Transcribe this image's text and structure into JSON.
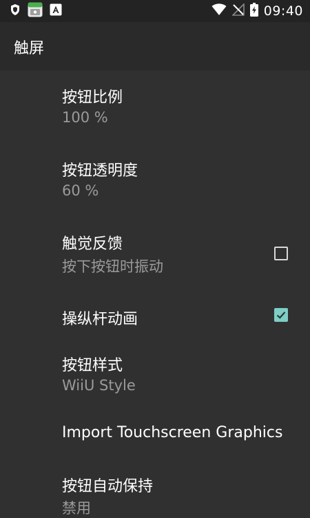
{
  "status_bar": {
    "time": "09:40",
    "left_icons": [
      "shield-icon",
      "app-notification-icon",
      "font-a-icon"
    ],
    "right_icons": [
      "wifi-icon",
      "no-signal-icon",
      "battery-charging-icon"
    ]
  },
  "toolbar": {
    "title": "触屏"
  },
  "settings": [
    {
      "title": "按钮比例",
      "summary": "100 %"
    },
    {
      "title": "按钮透明度",
      "summary": "60 %"
    },
    {
      "title": "触觉反馈",
      "summary": "按下按钮时振动",
      "checked": false
    },
    {
      "title": "操纵杆动画",
      "checked": true
    },
    {
      "title": "按钮样式",
      "summary": "WiiU Style"
    },
    {
      "title": "Import Touchscreen Graphics"
    },
    {
      "title": "按钮自动保持",
      "summary": "禁用"
    }
  ],
  "colors": {
    "background": "#303030",
    "toolbar": "#2a2a2a",
    "accent": "#7fcdc4",
    "summary_text": "#9a9a9a"
  }
}
